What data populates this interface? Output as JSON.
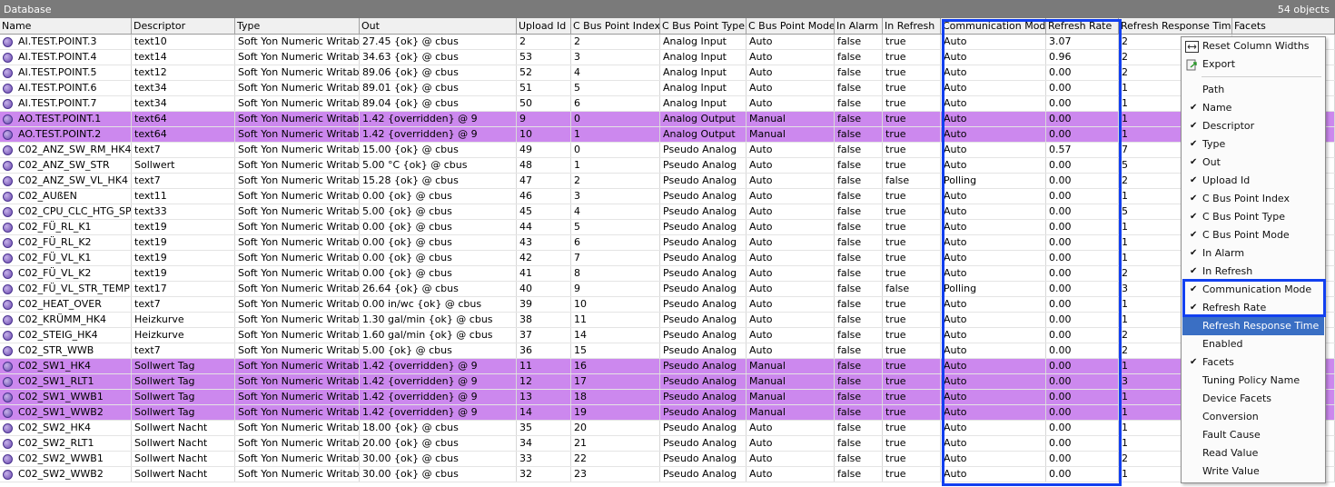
{
  "window": {
    "title": "Database",
    "object_count": "54 objects"
  },
  "columns": [
    "Name",
    "Descriptor",
    "Type",
    "Out",
    "Upload Id",
    "C Bus Point Index",
    "C Bus Point Type",
    "C Bus Point Mode",
    "In Alarm",
    "In Refresh",
    "Communication Mode",
    "Refresh Rate",
    "Refresh Response Time",
    "Facets"
  ],
  "rows": [
    {
      "name": "AI.TEST.POINT.3",
      "descriptor": "text10",
      "type": "Soft Yon Numeric Writable",
      "out": "27.45 {ok} @ cbus",
      "upload_id": "2",
      "index": "2",
      "bus_type": "Analog Input",
      "mode": "Auto",
      "in_alarm": "false",
      "in_refresh": "true",
      "comm_mode": "Auto",
      "refresh_rate": "3.07",
      "response": "2",
      "overridden": false
    },
    {
      "name": "AI.TEST.POINT.4",
      "descriptor": "text14",
      "type": "Soft Yon Numeric Writable",
      "out": "34.63 {ok} @ cbus",
      "upload_id": "53",
      "index": "3",
      "bus_type": "Analog Input",
      "mode": "Auto",
      "in_alarm": "false",
      "in_refresh": "true",
      "comm_mode": "Auto",
      "refresh_rate": "0.96",
      "response": "2",
      "overridden": false
    },
    {
      "name": "AI.TEST.POINT.5",
      "descriptor": "text12",
      "type": "Soft Yon Numeric Writable",
      "out": "89.06 {ok} @ cbus",
      "upload_id": "52",
      "index": "4",
      "bus_type": "Analog Input",
      "mode": "Auto",
      "in_alarm": "false",
      "in_refresh": "true",
      "comm_mode": "Auto",
      "refresh_rate": "0.00",
      "response": "2",
      "overridden": false
    },
    {
      "name": "AI.TEST.POINT.6",
      "descriptor": "text34",
      "type": "Soft Yon Numeric Writable",
      "out": "89.01 {ok} @ cbus",
      "upload_id": "51",
      "index": "5",
      "bus_type": "Analog Input",
      "mode": "Auto",
      "in_alarm": "false",
      "in_refresh": "true",
      "comm_mode": "Auto",
      "refresh_rate": "0.00",
      "response": "1",
      "overridden": false
    },
    {
      "name": "AI.TEST.POINT.7",
      "descriptor": "text34",
      "type": "Soft Yon Numeric Writable",
      "out": "89.04 {ok} @ cbus",
      "upload_id": "50",
      "index": "6",
      "bus_type": "Analog Input",
      "mode": "Auto",
      "in_alarm": "false",
      "in_refresh": "true",
      "comm_mode": "Auto",
      "refresh_rate": "0.00",
      "response": "1",
      "overridden": false
    },
    {
      "name": "AO.TEST.POINT.1",
      "descriptor": "text64",
      "type": "Soft Yon Numeric Writable",
      "out": "1.42 {overridden} @ 9",
      "upload_id": "9",
      "index": "0",
      "bus_type": "Analog Output",
      "mode": "Manual",
      "in_alarm": "false",
      "in_refresh": "true",
      "comm_mode": "Auto",
      "refresh_rate": "0.00",
      "response": "1",
      "overridden": true
    },
    {
      "name": "AO.TEST.POINT.2",
      "descriptor": "text64",
      "type": "Soft Yon Numeric Writable",
      "out": "1.42 {overridden} @ 9",
      "upload_id": "10",
      "index": "1",
      "bus_type": "Analog Output",
      "mode": "Manual",
      "in_alarm": "false",
      "in_refresh": "true",
      "comm_mode": "Auto",
      "refresh_rate": "0.00",
      "response": "1",
      "overridden": true
    },
    {
      "name": "C02_ANZ_SW_RM_HK4",
      "descriptor": "text7",
      "type": "Soft Yon Numeric Writable",
      "out": "15.00 {ok} @ cbus",
      "upload_id": "49",
      "index": "0",
      "bus_type": "Pseudo Analog",
      "mode": "Auto",
      "in_alarm": "false",
      "in_refresh": "true",
      "comm_mode": "Auto",
      "refresh_rate": "0.57",
      "response": "7",
      "overridden": false
    },
    {
      "name": "C02_ANZ_SW_STR",
      "descriptor": "Sollwert",
      "type": "Soft Yon Numeric Writable",
      "out": "5.00 °C {ok} @ cbus",
      "upload_id": "48",
      "index": "1",
      "bus_type": "Pseudo Analog",
      "mode": "Auto",
      "in_alarm": "false",
      "in_refresh": "true",
      "comm_mode": "Auto",
      "refresh_rate": "0.00",
      "response": "5",
      "overridden": false
    },
    {
      "name": "C02_ANZ_SW_VL_HK4",
      "descriptor": "text7",
      "type": "Soft Yon Numeric Writable",
      "out": "15.28 {ok} @ cbus",
      "upload_id": "47",
      "index": "2",
      "bus_type": "Pseudo Analog",
      "mode": "Auto",
      "in_alarm": "false",
      "in_refresh": "false",
      "comm_mode": "Polling",
      "refresh_rate": "0.00",
      "response": "2",
      "overridden": false
    },
    {
      "name": "C02_AUßEN",
      "descriptor": "text11",
      "type": "Soft Yon Numeric Writable",
      "out": "0.00 {ok} @ cbus",
      "upload_id": "46",
      "index": "3",
      "bus_type": "Pseudo Analog",
      "mode": "Auto",
      "in_alarm": "false",
      "in_refresh": "true",
      "comm_mode": "Auto",
      "refresh_rate": "0.00",
      "response": "1",
      "overridden": false
    },
    {
      "name": "C02_CPU_CLC_HTG_SP",
      "descriptor": "text33",
      "type": "Soft Yon Numeric Writable",
      "out": "5.00 {ok} @ cbus",
      "upload_id": "45",
      "index": "4",
      "bus_type": "Pseudo Analog",
      "mode": "Auto",
      "in_alarm": "false",
      "in_refresh": "true",
      "comm_mode": "Auto",
      "refresh_rate": "0.00",
      "response": "5",
      "overridden": false
    },
    {
      "name": "C02_FÜ_RL_K1",
      "descriptor": "text19",
      "type": "Soft Yon Numeric Writable",
      "out": "0.00 {ok} @ cbus",
      "upload_id": "44",
      "index": "5",
      "bus_type": "Pseudo Analog",
      "mode": "Auto",
      "in_alarm": "false",
      "in_refresh": "true",
      "comm_mode": "Auto",
      "refresh_rate": "0.00",
      "response": "1",
      "overridden": false
    },
    {
      "name": "C02_FÜ_RL_K2",
      "descriptor": "text19",
      "type": "Soft Yon Numeric Writable",
      "out": "0.00 {ok} @ cbus",
      "upload_id": "43",
      "index": "6",
      "bus_type": "Pseudo Analog",
      "mode": "Auto",
      "in_alarm": "false",
      "in_refresh": "true",
      "comm_mode": "Auto",
      "refresh_rate": "0.00",
      "response": "1",
      "overridden": false
    },
    {
      "name": "C02_FÜ_VL_K1",
      "descriptor": "text19",
      "type": "Soft Yon Numeric Writable",
      "out": "0.00 {ok} @ cbus",
      "upload_id": "42",
      "index": "7",
      "bus_type": "Pseudo Analog",
      "mode": "Auto",
      "in_alarm": "false",
      "in_refresh": "true",
      "comm_mode": "Auto",
      "refresh_rate": "0.00",
      "response": "1",
      "overridden": false
    },
    {
      "name": "C02_FÜ_VL_K2",
      "descriptor": "text19",
      "type": "Soft Yon Numeric Writable",
      "out": "0.00 {ok} @ cbus",
      "upload_id": "41",
      "index": "8",
      "bus_type": "Pseudo Analog",
      "mode": "Auto",
      "in_alarm": "false",
      "in_refresh": "true",
      "comm_mode": "Auto",
      "refresh_rate": "0.00",
      "response": "2",
      "overridden": false
    },
    {
      "name": "C02_FÜ_VL_STR_TEMP",
      "descriptor": "text17",
      "type": "Soft Yon Numeric Writable",
      "out": "26.64 {ok} @ cbus",
      "upload_id": "40",
      "index": "9",
      "bus_type": "Pseudo Analog",
      "mode": "Auto",
      "in_alarm": "false",
      "in_refresh": "false",
      "comm_mode": "Polling",
      "refresh_rate": "0.00",
      "response": "3",
      "overridden": false
    },
    {
      "name": "C02_HEAT_OVER",
      "descriptor": "text7",
      "type": "Soft Yon Numeric Writable",
      "out": "0.00 in/wc {ok} @ cbus",
      "upload_id": "39",
      "index": "10",
      "bus_type": "Pseudo Analog",
      "mode": "Auto",
      "in_alarm": "false",
      "in_refresh": "true",
      "comm_mode": "Auto",
      "refresh_rate": "0.00",
      "response": "1",
      "overridden": false
    },
    {
      "name": "C02_KRÜMM_HK4",
      "descriptor": "Heizkurve",
      "type": "Soft Yon Numeric Writable",
      "out": "1.30 gal/min {ok} @ cbus",
      "upload_id": "38",
      "index": "11",
      "bus_type": "Pseudo Analog",
      "mode": "Auto",
      "in_alarm": "false",
      "in_refresh": "true",
      "comm_mode": "Auto",
      "refresh_rate": "0.00",
      "response": "1",
      "overridden": false
    },
    {
      "name": "C02_STEIG_HK4",
      "descriptor": "Heizkurve",
      "type": "Soft Yon Numeric Writable",
      "out": "1.60 gal/min {ok} @ cbus",
      "upload_id": "37",
      "index": "14",
      "bus_type": "Pseudo Analog",
      "mode": "Auto",
      "in_alarm": "false",
      "in_refresh": "true",
      "comm_mode": "Auto",
      "refresh_rate": "0.00",
      "response": "2",
      "overridden": false
    },
    {
      "name": "C02_STR_WWB",
      "descriptor": "text7",
      "type": "Soft Yon Numeric Writable",
      "out": "5.00 {ok} @ cbus",
      "upload_id": "36",
      "index": "15",
      "bus_type": "Pseudo Analog",
      "mode": "Auto",
      "in_alarm": "false",
      "in_refresh": "true",
      "comm_mode": "Auto",
      "refresh_rate": "0.00",
      "response": "2",
      "overridden": false
    },
    {
      "name": "C02_SW1_HK4",
      "descriptor": "Sollwert Tag",
      "type": "Soft Yon Numeric Writable",
      "out": "1.42 {overridden} @ 9",
      "upload_id": "11",
      "index": "16",
      "bus_type": "Pseudo Analog",
      "mode": "Manual",
      "in_alarm": "false",
      "in_refresh": "true",
      "comm_mode": "Auto",
      "refresh_rate": "0.00",
      "response": "1",
      "overridden": true
    },
    {
      "name": "C02_SW1_RLT1",
      "descriptor": "Sollwert Tag",
      "type": "Soft Yon Numeric Writable",
      "out": "1.42 {overridden} @ 9",
      "upload_id": "12",
      "index": "17",
      "bus_type": "Pseudo Analog",
      "mode": "Manual",
      "in_alarm": "false",
      "in_refresh": "true",
      "comm_mode": "Auto",
      "refresh_rate": "0.00",
      "response": "3",
      "overridden": true
    },
    {
      "name": "C02_SW1_WWB1",
      "descriptor": "Sollwert Tag",
      "type": "Soft Yon Numeric Writable",
      "out": "1.42 {overridden} @ 9",
      "upload_id": "13",
      "index": "18",
      "bus_type": "Pseudo Analog",
      "mode": "Manual",
      "in_alarm": "false",
      "in_refresh": "true",
      "comm_mode": "Auto",
      "refresh_rate": "0.00",
      "response": "1",
      "overridden": true
    },
    {
      "name": "C02_SW1_WWB2",
      "descriptor": "Sollwert Tag",
      "type": "Soft Yon Numeric Writable",
      "out": "1.42 {overridden} @ 9",
      "upload_id": "14",
      "index": "19",
      "bus_type": "Pseudo Analog",
      "mode": "Manual",
      "in_alarm": "false",
      "in_refresh": "true",
      "comm_mode": "Auto",
      "refresh_rate": "0.00",
      "response": "1",
      "overridden": true
    },
    {
      "name": "C02_SW2_HK4",
      "descriptor": "Sollwert Nacht",
      "type": "Soft Yon Numeric Writable",
      "out": "18.00 {ok} @ cbus",
      "upload_id": "35",
      "index": "20",
      "bus_type": "Pseudo Analog",
      "mode": "Auto",
      "in_alarm": "false",
      "in_refresh": "true",
      "comm_mode": "Auto",
      "refresh_rate": "0.00",
      "response": "1",
      "overridden": false
    },
    {
      "name": "C02_SW2_RLT1",
      "descriptor": "Sollwert Nacht",
      "type": "Soft Yon Numeric Writable",
      "out": "20.00 {ok} @ cbus",
      "upload_id": "34",
      "index": "21",
      "bus_type": "Pseudo Analog",
      "mode": "Auto",
      "in_alarm": "false",
      "in_refresh": "true",
      "comm_mode": "Auto",
      "refresh_rate": "0.00",
      "response": "1",
      "overridden": false
    },
    {
      "name": "C02_SW2_WWB1",
      "descriptor": "Sollwert Nacht",
      "type": "Soft Yon Numeric Writable",
      "out": "30.00 {ok} @ cbus",
      "upload_id": "33",
      "index": "22",
      "bus_type": "Pseudo Analog",
      "mode": "Auto",
      "in_alarm": "false",
      "in_refresh": "true",
      "comm_mode": "Auto",
      "refresh_rate": "0.00",
      "response": "2",
      "overridden": false
    },
    {
      "name": "C02_SW2_WWB2",
      "descriptor": "Sollwert Nacht",
      "type": "Soft Yon Numeric Writable",
      "out": "30.00 {ok} @ cbus",
      "upload_id": "32",
      "index": "23",
      "bus_type": "Pseudo Analog",
      "mode": "Auto",
      "in_alarm": "false",
      "in_refresh": "true",
      "comm_mode": "Auto",
      "refresh_rate": "0.00",
      "response": "1",
      "overridden": false
    }
  ],
  "context_menu": {
    "actions": [
      {
        "label": "Reset Column Widths",
        "icon": "reset-columns-icon"
      },
      {
        "label": "Export",
        "icon": "export-icon"
      }
    ],
    "columns": [
      {
        "label": "Path",
        "checked": false
      },
      {
        "label": "Name",
        "checked": true
      },
      {
        "label": "Descriptor",
        "checked": true
      },
      {
        "label": "Type",
        "checked": true
      },
      {
        "label": "Out",
        "checked": true
      },
      {
        "label": "Upload Id",
        "checked": true
      },
      {
        "label": "C Bus Point Index",
        "checked": true
      },
      {
        "label": "C Bus Point Type",
        "checked": true
      },
      {
        "label": "C Bus Point Mode",
        "checked": true
      },
      {
        "label": "In Alarm",
        "checked": true
      },
      {
        "label": "In Refresh",
        "checked": true
      },
      {
        "label": "Communication Mode",
        "checked": true
      },
      {
        "label": "Refresh Rate",
        "checked": true
      },
      {
        "label": "Refresh Response Time",
        "checked": false,
        "active": true
      },
      {
        "label": "Enabled",
        "checked": false
      },
      {
        "label": "Facets",
        "checked": true
      },
      {
        "label": "Tuning Policy Name",
        "checked": false
      },
      {
        "label": "Device Facets",
        "checked": false
      },
      {
        "label": "Conversion",
        "checked": false
      },
      {
        "label": "Fault Cause",
        "checked": false
      },
      {
        "label": "Read Value",
        "checked": false
      },
      {
        "label": "Write Value",
        "checked": false
      }
    ]
  },
  "colors": {
    "titlebar": "#7a7a7a",
    "overridden_row": "#cc88ee",
    "highlight_box": "#1240f0",
    "menu_active": "#3a6fc4"
  },
  "icons": {
    "row_status": "point-status-icon",
    "checkmark": "✔",
    "column_chooser": "column-chooser-icon"
  }
}
